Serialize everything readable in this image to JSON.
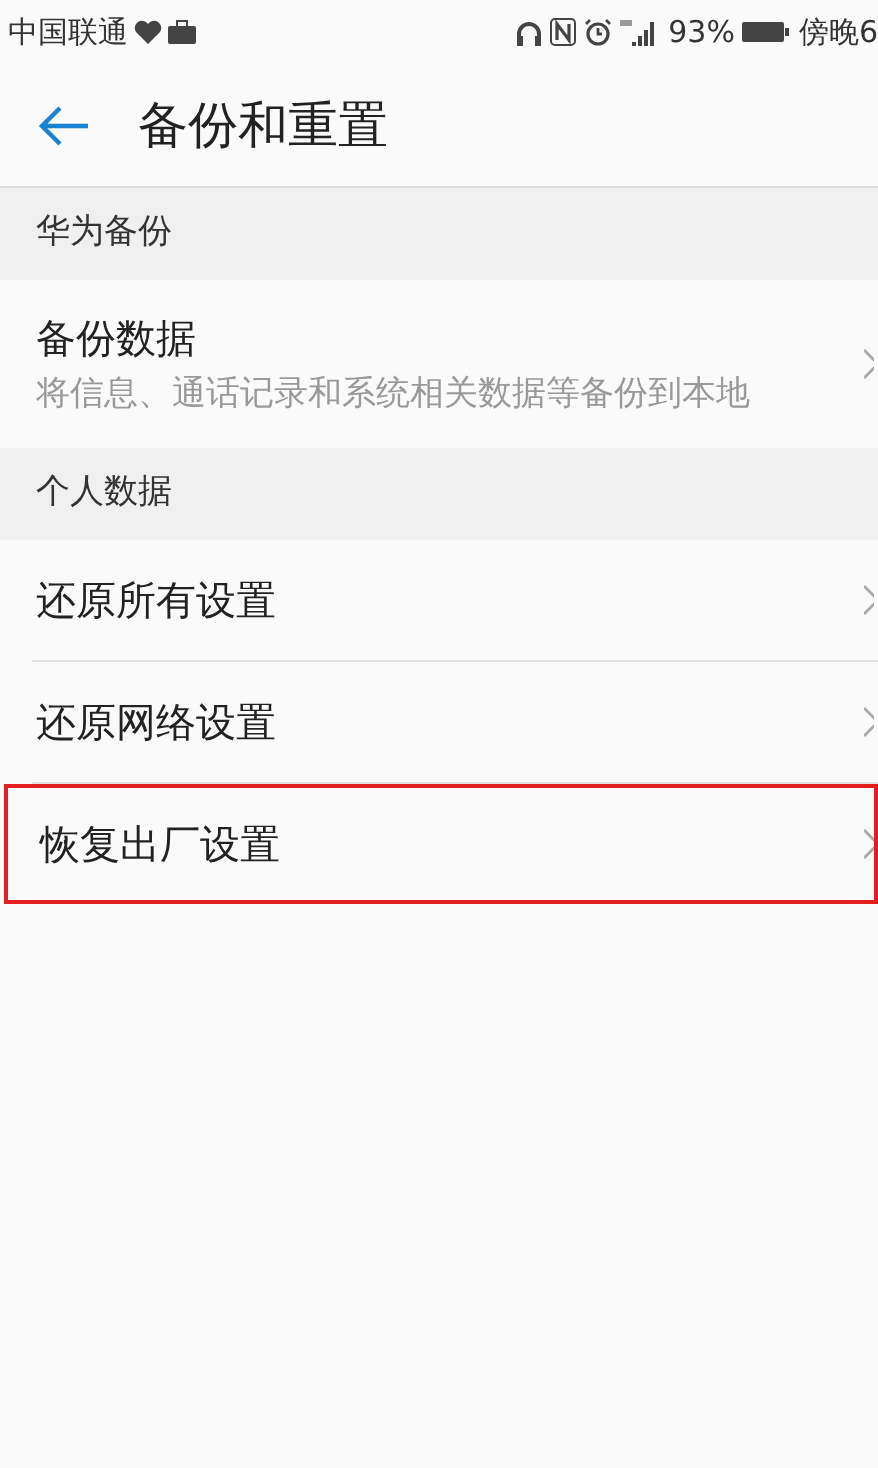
{
  "status_bar": {
    "carrier": "中国联通",
    "battery_percent": "93%",
    "time": "傍晚6"
  },
  "header": {
    "title": "备份和重置"
  },
  "sections": [
    {
      "title": "华为备份",
      "items": [
        {
          "title": "备份数据",
          "subtitle": "将信息、通话记录和系统相关数据等备份到本地",
          "highlighted": false
        }
      ]
    },
    {
      "title": "个人数据",
      "items": [
        {
          "title": "还原所有设置",
          "highlighted": false
        },
        {
          "title": "还原网络设置",
          "highlighted": false
        },
        {
          "title": "恢复出厂设置",
          "highlighted": true
        }
      ]
    }
  ]
}
